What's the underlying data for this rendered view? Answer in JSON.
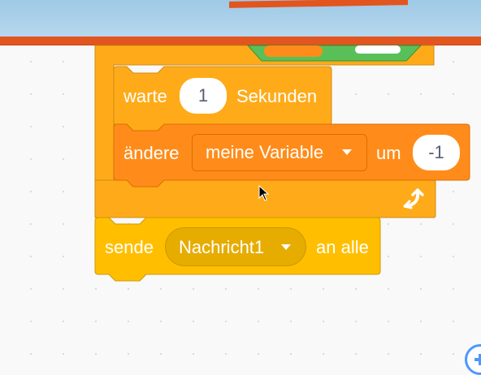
{
  "wait_block": {
    "prefix": "warte",
    "seconds_value": "1",
    "suffix": "Sekunden"
  },
  "change_block": {
    "prefix": "ändere",
    "variable": "meine Variable",
    "mid": "um",
    "amount": "-1"
  },
  "broadcast_block": {
    "prefix": "sende",
    "message": "Nachricht1",
    "suffix": "an alle"
  },
  "loop_icon": "repeat-arrow-icon",
  "colors": {
    "control": "#ffab19",
    "variables": "#ff8c1a",
    "events": "#ffbf00",
    "operators": "#59c059",
    "stage_accent": "#e2551f"
  }
}
